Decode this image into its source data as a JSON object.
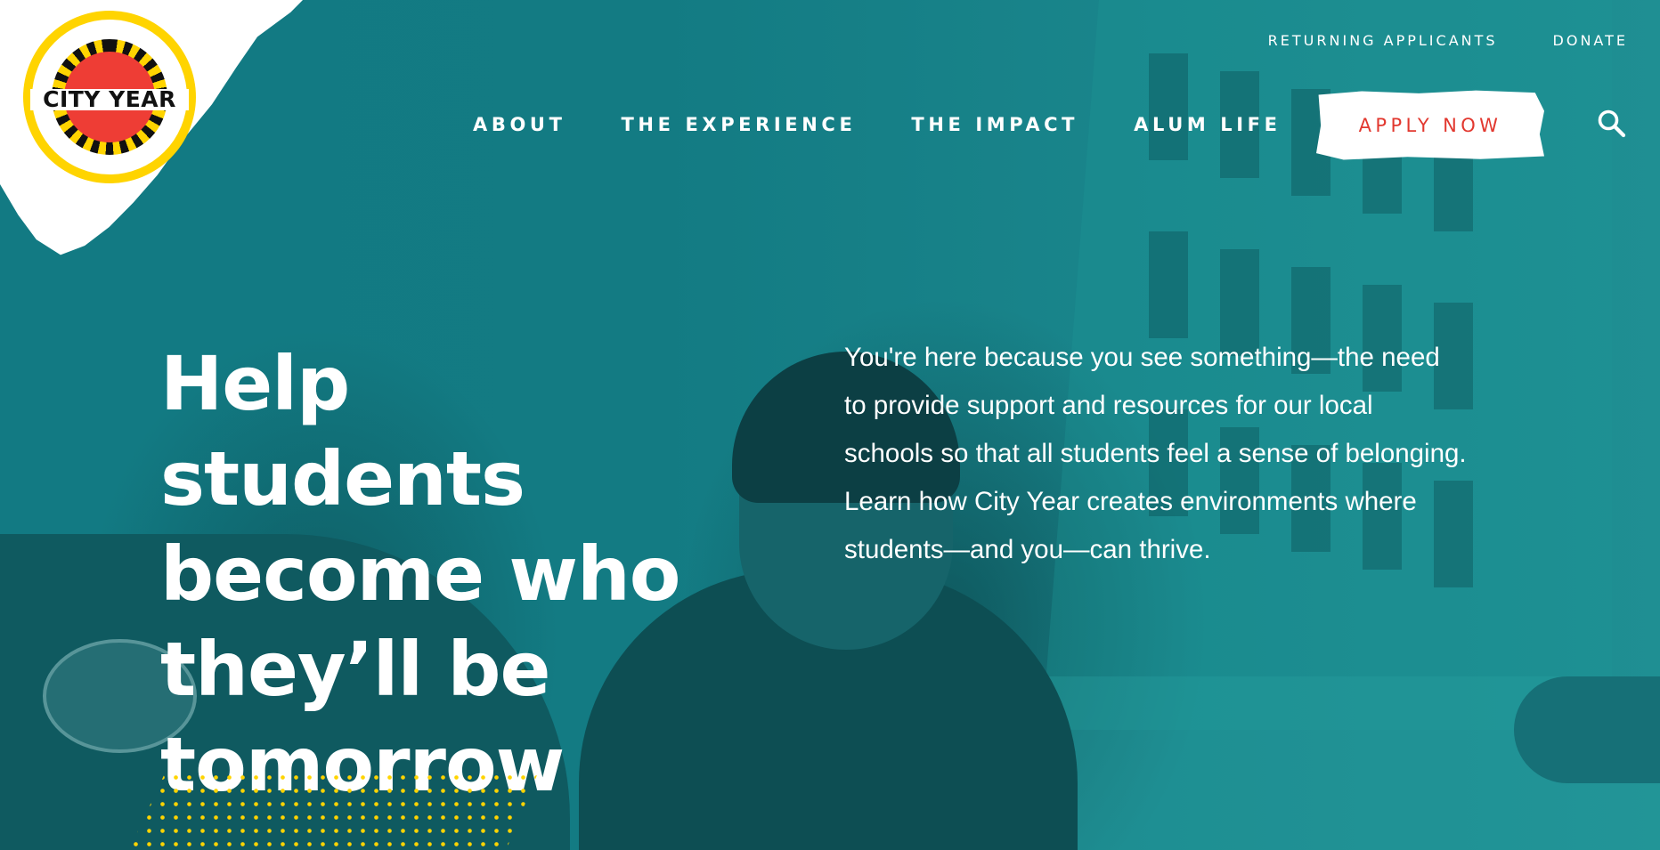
{
  "logo": {
    "text": "CITY YEAR",
    "colors": {
      "ring": "#ffd400",
      "sun": "#ee3d35",
      "text": "#111111"
    }
  },
  "utility_nav": [
    {
      "label": "RETURNING APPLICANTS"
    },
    {
      "label": "DONATE"
    }
  ],
  "main_nav": [
    {
      "label": "ABOUT"
    },
    {
      "label": "THE EXPERIENCE"
    },
    {
      "label": "THE IMPACT"
    },
    {
      "label": "ALUM LIFE"
    }
  ],
  "apply_button": {
    "label": "APPLY NOW"
  },
  "search": {
    "icon": "search-icon"
  },
  "hero": {
    "headline": "Help students become who they’ll be tomorrow",
    "intro": "You're here because you see something—the need to provide support and resources for our local schools so that all students feel a sense of belonging. Learn how City Year creates environments where students—and you—can thrive."
  },
  "colors": {
    "background": "#137a82",
    "accent": "#e2382f",
    "dots": "#ffd400",
    "text": "#ffffff"
  }
}
